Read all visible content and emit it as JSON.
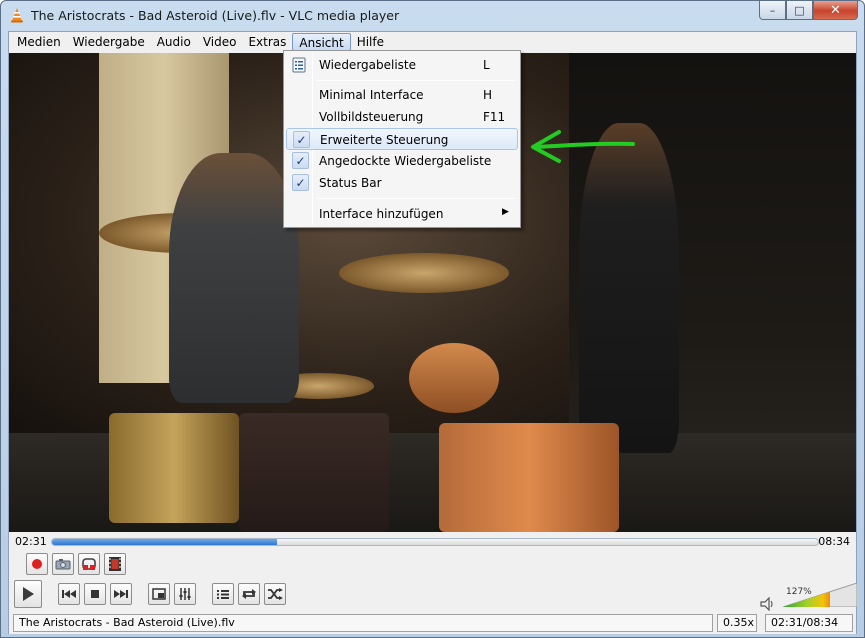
{
  "window": {
    "title": "The Aristocrats - Bad Asteroid (Live).flv - VLC media player",
    "minimize_glyph": "–",
    "maximize_glyph": "□",
    "close_glyph": "✕"
  },
  "menubar": {
    "items": [
      "Medien",
      "Wiedergabe",
      "Audio",
      "Video",
      "Extras",
      "Ansicht",
      "Hilfe"
    ]
  },
  "ansicht_menu": {
    "items": [
      {
        "label": "Wiedergabeliste",
        "shortcut": "L"
      },
      {
        "label": "Minimal Interface",
        "shortcut": "H"
      },
      {
        "label": "Vollbildsteuerung",
        "shortcut": "F11"
      },
      {
        "label": "Erweiterte Steuerung",
        "checked": true
      },
      {
        "label": "Angedockte Wiedergabeliste",
        "checked": true
      },
      {
        "label": "Status Bar",
        "checked": true
      },
      {
        "label": "Interface hinzufügen",
        "submenu": true
      }
    ],
    "check_glyph": "✓",
    "submenu_glyph": "▶"
  },
  "playback": {
    "elapsed": "02:31",
    "total": "08:34",
    "progress": 0.2937
  },
  "controls": {
    "advanced": [
      "record-icon",
      "snapshot-icon",
      "loop-ab-icon",
      "frame-step-icon"
    ],
    "main": [
      "play-icon",
      "previous-icon",
      "stop-icon",
      "next-icon",
      "fullscreen-icon",
      "equalizer-icon",
      "playlist-icon",
      "repeat-icon",
      "shuffle-icon"
    ]
  },
  "volume": {
    "label": "127%",
    "level": 1.27
  },
  "statusbar": {
    "filename": "The Aristocrats - Bad Asteroid (Live).flv",
    "speed": "0.35x",
    "time": "02:31/08:34"
  },
  "colors": {
    "seek_fill": "#2f78cf",
    "annotation": "#22cc22",
    "record": "#e02020"
  }
}
